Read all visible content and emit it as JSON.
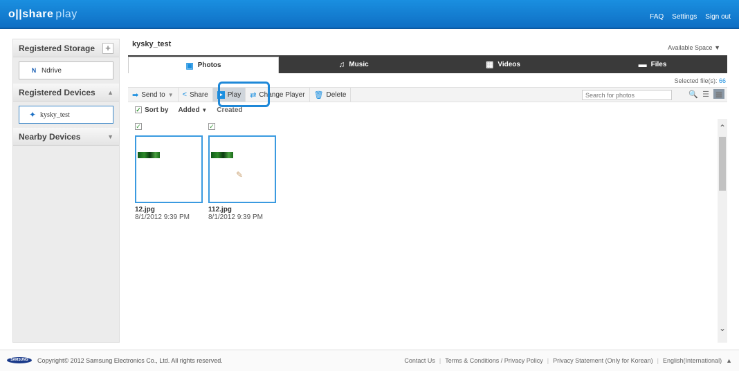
{
  "app": {
    "logo_main": "o||share",
    "logo_sub": "play",
    "top_links": [
      "FAQ",
      "Settings",
      "Sign out"
    ]
  },
  "sidebar": {
    "storage_heading": "Registered Storage",
    "storage_items": [
      {
        "label": "Ndrive",
        "icon": "ndrive-icon"
      }
    ],
    "devices_heading": "Registered Devices",
    "device_items": [
      {
        "label": "kysky_test",
        "icon": "device-icon"
      }
    ],
    "nearby_heading": "Nearby Devices"
  },
  "main": {
    "device_title": "kysky_test",
    "available_space": "Available Space",
    "tabs": [
      {
        "label": "Photos",
        "icon": "photos-icon",
        "active": true
      },
      {
        "label": "Music",
        "icon": "music-icon",
        "active": false
      },
      {
        "label": "Videos",
        "icon": "videos-icon",
        "active": false
      },
      {
        "label": "Files",
        "icon": "files-icon",
        "active": false
      }
    ],
    "selected_files_label": "Selected file(s):",
    "selected_files_count": "66",
    "toolbar": {
      "send_to": "Send to",
      "share": "Share",
      "play": "Play",
      "change_player": "Change Player",
      "delete": "Delete"
    },
    "search_placeholder": "Search for photos",
    "sort": {
      "label": "Sort by",
      "added": "Added",
      "created": "Created"
    },
    "photos": [
      {
        "name": "12.jpg",
        "date": "8/1/2012 9:39 PM",
        "checked": true
      },
      {
        "name": "112.jpg",
        "date": "8/1/2012 9:39 PM",
        "checked": true
      }
    ]
  },
  "footer": {
    "brand": "SAMSUNG",
    "copyright": "Copyright© 2012 Samsung Electronics Co., Ltd. All rights reserved.",
    "links": [
      "Contact Us",
      "Terms & Conditions / Privacy Policy",
      "Privacy Statement (Only for Korean)",
      "English(International)"
    ]
  },
  "colors": {
    "accent": "#1a8fe0",
    "topbar": "#0f6fc4",
    "tabbar": "#3a3a3a"
  }
}
